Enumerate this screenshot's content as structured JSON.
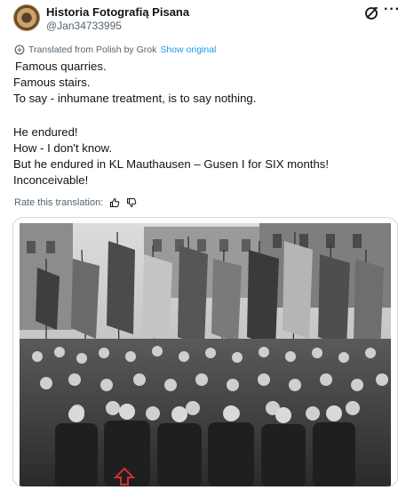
{
  "author": {
    "name": "Historia Fotografią Pisana",
    "handle": "@Jan34733995"
  },
  "icons": {
    "avatar": "avatar-image",
    "grok": "grok-icon",
    "more": "more-icon",
    "translate": "translate-icon",
    "like": "thumbs-up-icon",
    "dislike": "thumbs-down-icon"
  },
  "translation": {
    "notice": "Translated from Polish by Grok",
    "show_original": "Show original"
  },
  "tweet": {
    "lines_1": [
      "Famous quarries.",
      "Famous stairs.",
      "To say - inhumane treatment, is to say nothing."
    ],
    "lines_2": [
      "He endured!",
      "How - I don't know.",
      "But he endured in KL Mauthausen – Gusen I for SIX months!",
      "Inconceivable!"
    ]
  },
  "rate": {
    "label": "Rate this translation:"
  },
  "colors": {
    "link": "#1d9bf0",
    "secondary_text": "#536471",
    "marker": "#d32f2f"
  }
}
